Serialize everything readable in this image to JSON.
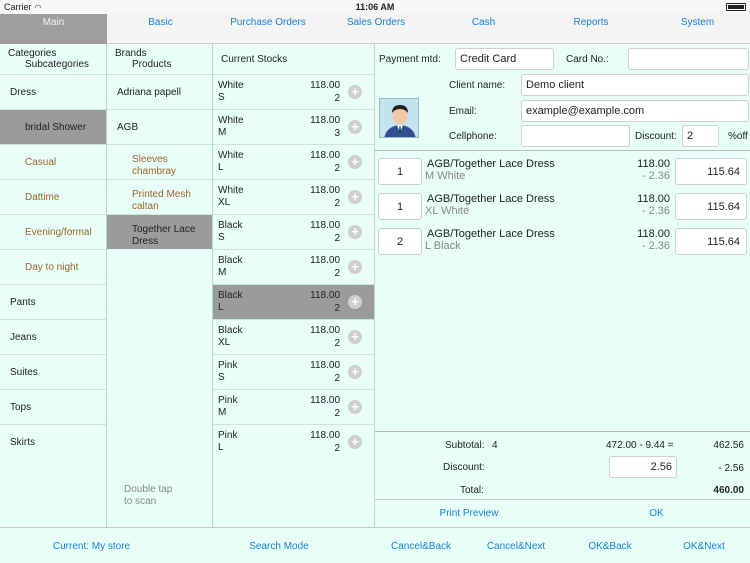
{
  "status": {
    "carrier": "Carrier",
    "time": "11:06 AM"
  },
  "tabs": [
    "Main",
    "Basic",
    "Purchase Orders",
    "Sales Orders",
    "Cash",
    "Reports",
    "System"
  ],
  "categories": {
    "header": [
      "Categories",
      "Subcategories"
    ],
    "items": [
      "Dress",
      "bridal Shower",
      "Casual",
      "Dattime",
      "Evening/formal",
      "Day to night",
      "Pants",
      "Jeans",
      "Suites",
      "Tops",
      "Skirts"
    ]
  },
  "brands": {
    "header": [
      "Brands",
      "Products"
    ],
    "items": [
      "Adriana papell",
      "AGB",
      "Sleeves chambray",
      "Printed Mesh caltan",
      "Together Lace Dress"
    ],
    "scan_hint": [
      "Double tap",
      "to scan"
    ]
  },
  "stocks": {
    "header": "Current Stocks",
    "items": [
      {
        "color": "White",
        "size": "S",
        "price": "118.00",
        "qty": "2"
      },
      {
        "color": "White",
        "size": "M",
        "price": "118.00",
        "qty": "3"
      },
      {
        "color": "White",
        "size": "L",
        "price": "118.00",
        "qty": "2"
      },
      {
        "color": "White",
        "size": "XL",
        "price": "118.00",
        "qty": "2"
      },
      {
        "color": "Black",
        "size": "S",
        "price": "118.00",
        "qty": "2"
      },
      {
        "color": "Black",
        "size": "M",
        "price": "118.00",
        "qty": "2"
      },
      {
        "color": "Black",
        "size": "L",
        "price": "118.00",
        "qty": "2"
      },
      {
        "color": "Black",
        "size": "XL",
        "price": "118.00",
        "qty": "2"
      },
      {
        "color": "Pink",
        "size": "S",
        "price": "118.00",
        "qty": "2"
      },
      {
        "color": "Pink",
        "size": "M",
        "price": "118.00",
        "qty": "2"
      },
      {
        "color": "Pink",
        "size": "L",
        "price": "118.00",
        "qty": "2"
      }
    ]
  },
  "payment": {
    "method_label": "Payment mtd:",
    "method_value": "Credit Card",
    "card_label": "Card No.:",
    "card_value": "",
    "client_label": "Client name:",
    "client_value": "Demo client",
    "email_label": "Email:",
    "email_value": "example@example.com",
    "cell_label": "Cellphone:",
    "cell_value": "",
    "discount_label": "Discount:",
    "discount_value": "2",
    "discount_unit": "%off"
  },
  "orders": [
    {
      "qty": "1",
      "name": "AGB/Together Lace Dress",
      "variant": "M White",
      "price": "118.00",
      "disc": "- 2.36",
      "total": "115.64"
    },
    {
      "qty": "1",
      "name": "AGB/Together Lace Dress",
      "variant": "XL White",
      "price": "118.00",
      "disc": "- 2.36",
      "total": "115.64"
    },
    {
      "qty": "2",
      "name": "AGB/Together Lace Dress",
      "variant": "L Black",
      "price": "118.00",
      "disc": "- 2.36",
      "total": "115.64"
    }
  ],
  "summary": {
    "subtotal_label": "Subtotal:",
    "subtotal_count": "4",
    "subtotal_calc": "472.00 - 9.44 =",
    "subtotal_value": "462.56",
    "discount_label": "Discount:",
    "discount_input": "2.56",
    "discount_value": "- 2.56",
    "total_label": "Total:",
    "total_value": "460.00"
  },
  "actions": {
    "print_preview": "Print Preview",
    "ok": "OK"
  },
  "bottom": {
    "store": "Current: My store",
    "search": "Search Mode",
    "cancel_back": "Cancel&Back",
    "cancel_next": "Cancel&Next",
    "ok_back": "OK&Back",
    "ok_next": "OK&Next"
  },
  "selection": {
    "subcategory": 1,
    "product": 4,
    "stock": 6
  }
}
